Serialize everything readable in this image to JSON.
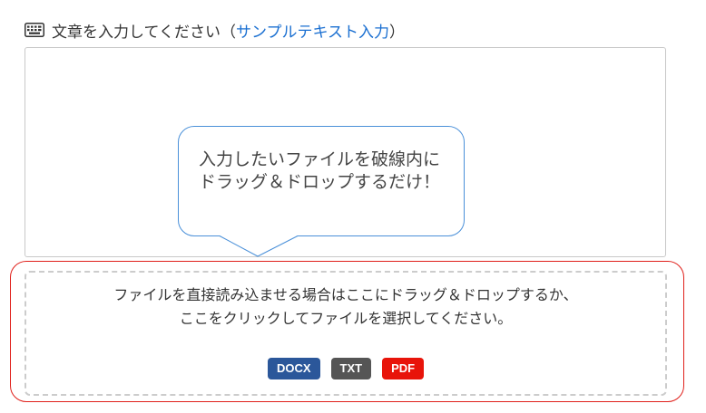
{
  "header": {
    "label": "文章を入力してください",
    "open_paren": "（",
    "sample_link": "サンプルテキスト入力",
    "close_paren": "）",
    "icon": "keyboard-icon"
  },
  "tooltip": {
    "text": "入力したいファイルを破線内にドラッグ＆ドロップするだけ！"
  },
  "dropzone": {
    "line1": "ファイルを直接読み込ませる場合はここにドラッグ＆ドロップするか、",
    "line2": "ここをクリックしてファイルを選択してください。",
    "badges": [
      {
        "label": "DOCX",
        "color": "#2b579a"
      },
      {
        "label": "TXT",
        "color": "#555555"
      },
      {
        "label": "PDF",
        "color": "#e8140a"
      }
    ]
  },
  "colors": {
    "link": "#1a6fd1",
    "tooltip_border": "#4a90d9",
    "highlight_frame": "#e0201b"
  }
}
